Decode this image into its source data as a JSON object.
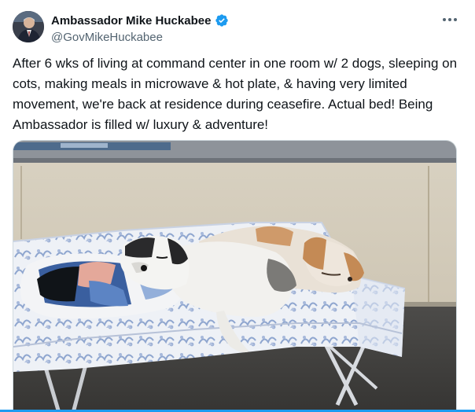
{
  "author": {
    "display_name": "Ambassador Mike Huckabee",
    "handle": "@GovMikeHuckabee",
    "verified": true,
    "verified_color": "#1d9bf0"
  },
  "icons": {
    "verified": "verified-badge-icon",
    "more": "more-options-icon"
  },
  "tweet": {
    "text": "After 6 wks of living at command center in one room w/ 2 dogs, sleeping on cots, making meals in microwave & hot plate, & having very limited movement, we're back at residence during ceasefire. Actual bed! Being Ambassador is filled w/ luxury & adventure!"
  },
  "colors": {
    "text_primary": "#0f1419",
    "text_secondary": "#536471",
    "accent": "#1d9bf0"
  }
}
